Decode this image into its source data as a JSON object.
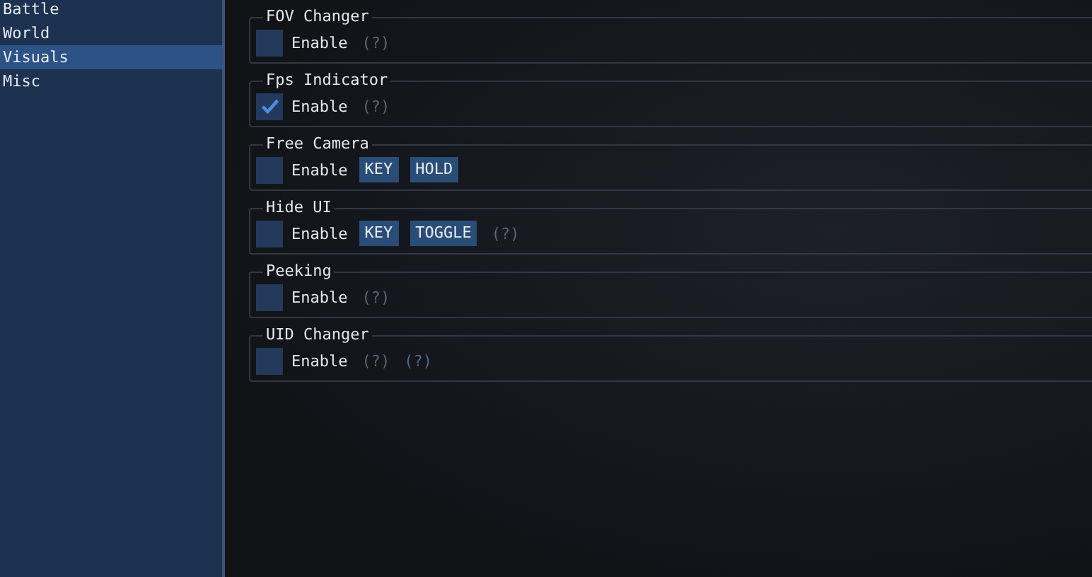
{
  "sidebar": {
    "items": [
      {
        "label": "Battle",
        "selected": false
      },
      {
        "label": "World",
        "selected": false
      },
      {
        "label": "Visuals",
        "selected": true
      },
      {
        "label": "Misc",
        "selected": false
      }
    ]
  },
  "groups": [
    {
      "title": "FOV Changer",
      "checked": false,
      "label": "Enable",
      "controls": [
        {
          "kind": "help",
          "text": "(?)",
          "color": "#5e6470"
        }
      ]
    },
    {
      "title": "Fps Indicator",
      "checked": true,
      "label": "Enable",
      "controls": [
        {
          "kind": "help",
          "text": "(?)",
          "color": "#5e6470"
        }
      ]
    },
    {
      "title": "Free Camera",
      "checked": false,
      "label": "Enable",
      "controls": [
        {
          "kind": "button",
          "text": "KEY"
        },
        {
          "kind": "button",
          "text": "HOLD"
        }
      ]
    },
    {
      "title": "Hide UI",
      "checked": false,
      "label": "Enable",
      "controls": [
        {
          "kind": "button",
          "text": "KEY"
        },
        {
          "kind": "button",
          "text": "TOGGLE"
        },
        {
          "kind": "help",
          "text": "(?)",
          "color": "#5e6470"
        }
      ]
    },
    {
      "title": "Peeking",
      "checked": false,
      "label": "Enable",
      "controls": [
        {
          "kind": "help",
          "text": "(?)",
          "color": "#5e6470"
        }
      ]
    },
    {
      "title": "UID Changer",
      "checked": false,
      "label": "Enable",
      "controls": [
        {
          "kind": "help",
          "text": "(?)",
          "color": "#5e6470"
        },
        {
          "kind": "help",
          "text": "(?)",
          "color": "#4d6a8c"
        }
      ]
    }
  ]
}
